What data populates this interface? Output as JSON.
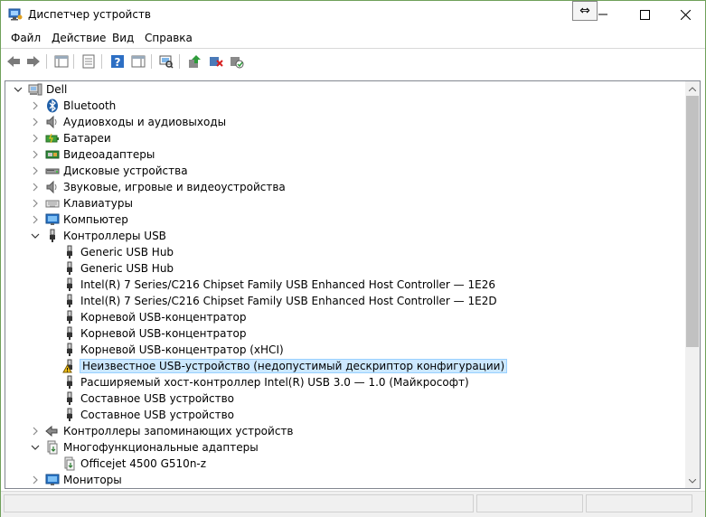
{
  "window": {
    "title": "Диспетчер устройств"
  },
  "menu": [
    "Файл",
    "Действие",
    "Вид",
    "Справка"
  ],
  "tree": [
    {
      "label": "Dell",
      "level": 0,
      "expander": "open",
      "icon": "computer"
    },
    {
      "label": "Bluetooth",
      "level": 1,
      "expander": "closed",
      "icon": "bluetooth"
    },
    {
      "label": "Аудиовходы и аудиовыходы",
      "level": 1,
      "expander": "closed",
      "icon": "speaker"
    },
    {
      "label": "Батареи",
      "level": 1,
      "expander": "closed",
      "icon": "battery"
    },
    {
      "label": "Видеоадаптеры",
      "level": 1,
      "expander": "closed",
      "icon": "display-adapter"
    },
    {
      "label": "Дисковые устройства",
      "level": 1,
      "expander": "closed",
      "icon": "disk"
    },
    {
      "label": "Звуковые, игровые и видеоустройства",
      "level": 1,
      "expander": "closed",
      "icon": "speaker"
    },
    {
      "label": "Клавиатуры",
      "level": 1,
      "expander": "closed",
      "icon": "keyboard"
    },
    {
      "label": "Компьютер",
      "level": 1,
      "expander": "closed",
      "icon": "monitor"
    },
    {
      "label": "Контроллеры USB",
      "level": 1,
      "expander": "open",
      "icon": "usb"
    },
    {
      "label": "Generic USB Hub",
      "level": 2,
      "expander": "none",
      "icon": "usb"
    },
    {
      "label": "Generic USB Hub",
      "level": 2,
      "expander": "none",
      "icon": "usb"
    },
    {
      "label": "Intel(R) 7 Series/C216 Chipset Family USB Enhanced Host Controller — 1E26",
      "level": 2,
      "expander": "none",
      "icon": "usb"
    },
    {
      "label": "Intel(R) 7 Series/C216 Chipset Family USB Enhanced Host Controller — 1E2D",
      "level": 2,
      "expander": "none",
      "icon": "usb"
    },
    {
      "label": "Корневой USB-концентратор",
      "level": 2,
      "expander": "none",
      "icon": "usb"
    },
    {
      "label": "Корневой USB-концентратор",
      "level": 2,
      "expander": "none",
      "icon": "usb"
    },
    {
      "label": "Корневой USB-концентратор (xHCI)",
      "level": 2,
      "expander": "none",
      "icon": "usb"
    },
    {
      "label": "Неизвестное USB-устройство (недопустимый дескриптор конфигурации)",
      "level": 2,
      "expander": "none",
      "icon": "usb-warning",
      "selected": true
    },
    {
      "label": "Расширяемый хост-контроллер Intel(R) USB 3.0 — 1.0 (Майкрософт)",
      "level": 2,
      "expander": "none",
      "icon": "usb"
    },
    {
      "label": "Составное USB устройство",
      "level": 2,
      "expander": "none",
      "icon": "usb"
    },
    {
      "label": "Составное USB устройство",
      "level": 2,
      "expander": "none",
      "icon": "usb"
    },
    {
      "label": "Контроллеры запоминающих устройств",
      "level": 1,
      "expander": "closed",
      "icon": "storage"
    },
    {
      "label": "Многофункциональные адаптеры",
      "level": 1,
      "expander": "open",
      "icon": "multifunction"
    },
    {
      "label": "Officejet 4500 G510n-z",
      "level": 2,
      "expander": "none",
      "icon": "multifunction"
    },
    {
      "label": "Мониторы",
      "level": 1,
      "expander": "closed",
      "icon": "monitor"
    }
  ],
  "colors": {
    "selection_bg": "#cce8ff",
    "selection_border": "#99d1ff",
    "window_border": "#6fa05a"
  }
}
